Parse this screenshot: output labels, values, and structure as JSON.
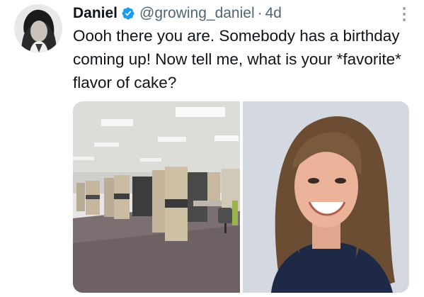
{
  "author": {
    "display_name": "Daniel",
    "handle": "@growing_daniel",
    "separator": "·",
    "timestamp": "4d"
  },
  "tweet": {
    "text": "Oooh there you are. Somebody has a birthday coming up! Now tell me, what is your *favorite* flavor of cake?"
  },
  "icons": {
    "verified": "verified-badge-icon",
    "more": "more-options-icon"
  },
  "media": [
    {
      "subject": "office-cubicles-photo"
    },
    {
      "subject": "smiling-person-photo"
    }
  ],
  "colors": {
    "text": "#0f1419",
    "secondary": "#536471",
    "verified": "#1d9bf0"
  }
}
